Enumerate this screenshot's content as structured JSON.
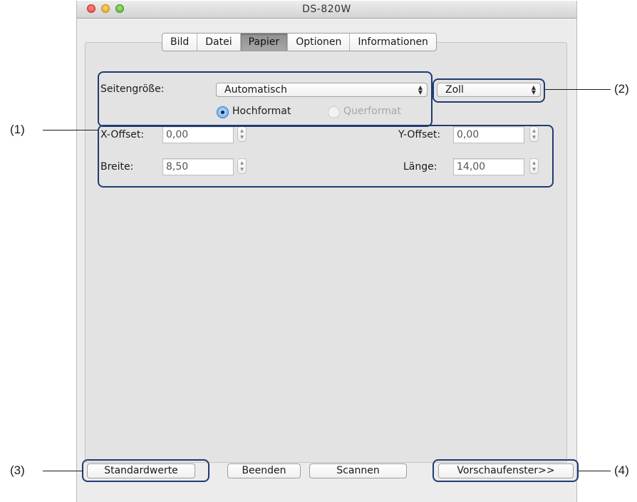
{
  "window": {
    "title": "DS-820W"
  },
  "tabs": [
    "Bild",
    "Datei",
    "Papier",
    "Optionen",
    "Informationen"
  ],
  "active_tab": "Papier",
  "paper": {
    "page_size_label": "Seitengröße:",
    "page_size_value": "Automatisch",
    "unit_value": "Zoll",
    "orientation": {
      "portrait_label": "Hochformat",
      "landscape_label": "Querformat",
      "selected": "Hochformat"
    },
    "x_offset_label": "X-Offset:",
    "x_offset_value": "0,00",
    "y_offset_label": "Y-Offset:",
    "y_offset_value": "0,00",
    "width_label": "Breite:",
    "width_value": "8,50",
    "length_label": "Länge:",
    "length_value": "14,00"
  },
  "buttons": {
    "defaults": "Standardwerte",
    "quit": "Beenden",
    "scan": "Scannen",
    "preview": "Vorschaufenster>>"
  },
  "annotations": {
    "one": "(1)",
    "two": "(2)",
    "three": "(3)",
    "four": "(4)"
  },
  "colors": {
    "callout": "#1e3b73",
    "radio_selected": "#5ea7ee"
  }
}
